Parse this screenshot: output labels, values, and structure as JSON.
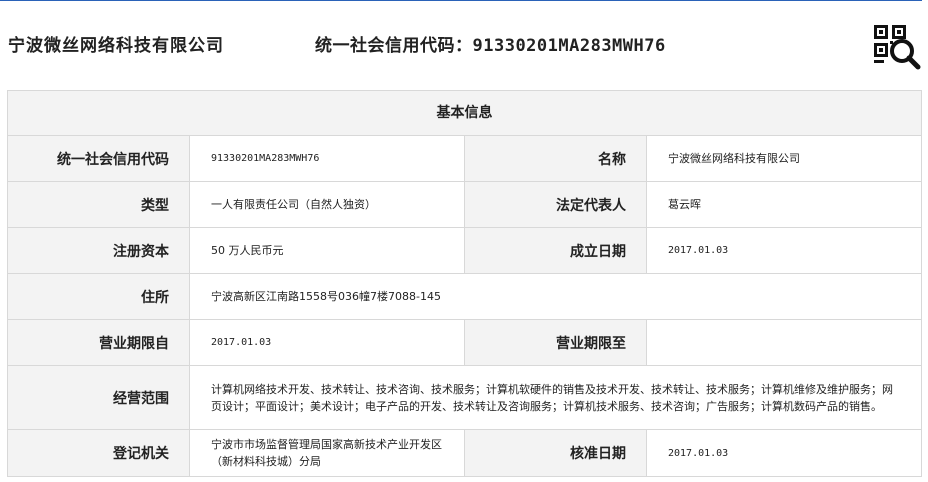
{
  "header": {
    "company_name": "宁波微丝网络科技有限公司",
    "credit_label": "统一社会信用代码：",
    "credit_code": "91330201MA283MWH76",
    "qr_icon": "qr-search-icon"
  },
  "table": {
    "title": "基本信息",
    "rows": [
      {
        "l1": "统一社会信用代码",
        "v1": "91330201MA283MWH76",
        "l2": "名称",
        "v2": "宁波微丝网络科技有限公司"
      },
      {
        "l1": "类型",
        "v1": "一人有限责任公司（自然人独资）",
        "l2": "法定代表人",
        "v2": "葛云晖"
      },
      {
        "l1": "注册资本",
        "v1": "50 万人民币元",
        "l2": "成立日期",
        "v2": "2017.01.03"
      },
      {
        "l1": "住所",
        "v1": "宁波高新区江南路1558号036幢7楼7088-145"
      },
      {
        "l1": "营业期限自",
        "v1": "2017.01.03",
        "l2": "营业期限至",
        "v2": ""
      },
      {
        "l1": "经营范围",
        "v1": "计算机网络技术开发、技术转让、技术咨询、技术服务；计算机软硬件的销售及技术开发、技术转让、技术服务；计算机维修及维护服务；网页设计；平面设计；美术设计；电子产品的开发、技术转让及咨询服务；计算机技术服务、技术咨询；广告服务；计算机数码产品的销售。"
      },
      {
        "l1": "登记机关",
        "v1": "宁波市市场监督管理局国家高新技术产业开发区（新材料科技城）分局",
        "l2": "核准日期",
        "v2": "2017.01.03"
      }
    ]
  }
}
